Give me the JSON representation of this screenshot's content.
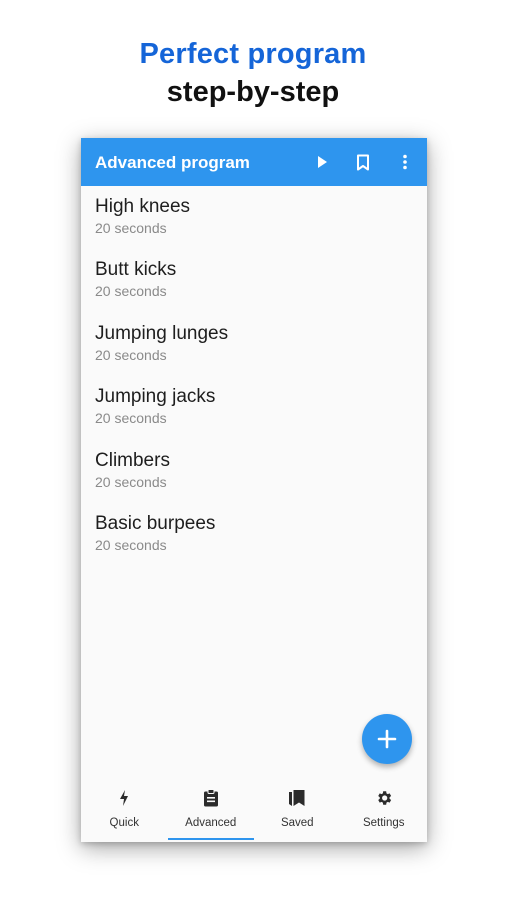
{
  "promo": {
    "headline_1": "Perfect program",
    "headline_2": "step-by-step"
  },
  "appbar": {
    "title": "Advanced program",
    "actions": [
      "play-icon",
      "bookmark-icon",
      "more-vert-icon"
    ],
    "color": "#2e95ee"
  },
  "exercises": [
    {
      "name": "High knees",
      "duration": "20 seconds"
    },
    {
      "name": "Butt kicks",
      "duration": "20 seconds"
    },
    {
      "name": "Jumping lunges",
      "duration": "20 seconds"
    },
    {
      "name": "Jumping jacks",
      "duration": "20 seconds"
    },
    {
      "name": "Climbers",
      "duration": "20 seconds"
    },
    {
      "name": "Basic burpees",
      "duration": "20 seconds"
    }
  ],
  "fab": {
    "icon": "plus-icon"
  },
  "bottom_nav": {
    "items": [
      {
        "label": "Quick",
        "icon": "bolt-icon",
        "active": false
      },
      {
        "label": "Advanced",
        "icon": "clipboard-icon",
        "active": true
      },
      {
        "label": "Saved",
        "icon": "bookmarks-icon",
        "active": false
      },
      {
        "label": "Settings",
        "icon": "gear-icon",
        "active": false
      }
    ]
  }
}
